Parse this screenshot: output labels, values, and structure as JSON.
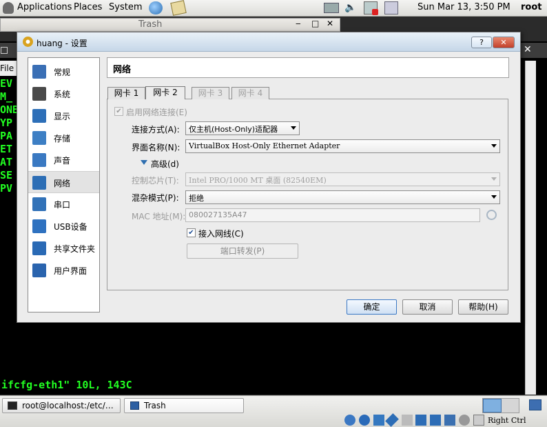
{
  "top_panel": {
    "menus": [
      "Applications",
      "Places",
      "System"
    ],
    "clock": "Sun Mar 13,  3:50 PM",
    "user": "root"
  },
  "background": {
    "trash_title": "Trash",
    "file_label": "File",
    "terminal_lines": [
      "EV",
      "M_",
      "ONB",
      "YP",
      "PA",
      "ET",
      "AT",
      "SE",
      "PV"
    ],
    "terminal_status": "ifcfg-eth1\" 10L, 143C"
  },
  "dialog": {
    "title": "huang - 设置",
    "help_button": "?",
    "close_button": "✕",
    "page_title": "网络",
    "sidebar": [
      {
        "label": "常规",
        "icon": "monitor-icon",
        "color": "#3a6fb5"
      },
      {
        "label": "系统",
        "icon": "chip-icon",
        "color": "#4a4a4a"
      },
      {
        "label": "显示",
        "icon": "display-icon",
        "color": "#2d6fb8"
      },
      {
        "label": "存储",
        "icon": "storage-icon",
        "color": "#3d7fc4"
      },
      {
        "label": "声音",
        "icon": "speaker-icon",
        "color": "#3a79c2"
      },
      {
        "label": "网络",
        "icon": "network-icon",
        "color": "#2d6eb5"
      },
      {
        "label": "串口",
        "icon": "serial-port-icon",
        "color": "#3272b8"
      },
      {
        "label": "USB设备",
        "icon": "usb-icon",
        "color": "#2f72c0"
      },
      {
        "label": "共享文件夹",
        "icon": "folder-icon",
        "color": "#2a6ab5"
      },
      {
        "label": "用户界面",
        "icon": "window-icon",
        "color": "#2a64ae"
      }
    ],
    "selected_index": 5,
    "tabs": [
      {
        "label": "网卡 1",
        "state": "normal"
      },
      {
        "label": "网卡 2",
        "state": "active"
      },
      {
        "label": "网卡 3",
        "state": "disabled"
      },
      {
        "label": "网卡 4",
        "state": "disabled"
      }
    ],
    "enable_adapter_label": "启用网络连接(E)",
    "attached_to_label": "连接方式(A):",
    "attached_to_value": "仅主机(Host-Only)适配器",
    "name_label": "界面名称(N):",
    "name_value": "VirtualBox Host-Only Ethernet Adapter",
    "advanced_label": "高级(d)",
    "adapter_type_label": "控制芯片(T):",
    "adapter_type_value": "Intel PRO/1000 MT 桌面 (82540EM)",
    "promiscuous_label": "混杂模式(P):",
    "promiscuous_value": "拒绝",
    "mac_label": "MAC 地址(M):",
    "mac_value": "080027135A47",
    "cable_label": "接入网线(C)",
    "port_forward_label": "端口转发(P)",
    "ok_button": "确定",
    "cancel_button": "取消",
    "help_btn": "帮助(H)"
  },
  "taskbar": {
    "tasks": [
      "root@localhost:/etc/…",
      "Trash"
    ],
    "status_text": "Right Ctrl"
  }
}
